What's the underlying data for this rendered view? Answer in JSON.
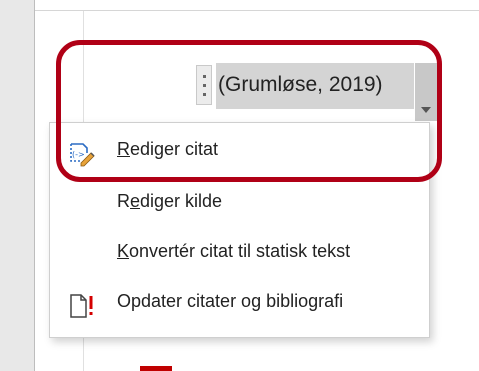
{
  "citation": {
    "text": "(Grumløse, 2019)"
  },
  "context_menu": {
    "items": [
      {
        "id": "edit-citation",
        "accel": "R",
        "rest": "ediger citat",
        "icon": "edit-citation-icon"
      },
      {
        "id": "edit-source",
        "pre": "R",
        "accel": "e",
        "rest": "diger kilde",
        "icon": ""
      },
      {
        "id": "convert-citation",
        "accel": "K",
        "rest": "onvertér citat til statisk tekst",
        "icon": ""
      },
      {
        "id": "update-citations",
        "accel": "",
        "rest": "Opdater citater og bibliografi",
        "icon": "update-document-icon"
      }
    ]
  },
  "colors": {
    "highlight": "#b00016",
    "field_shading": "#d4d4d4",
    "icon_blue": "#2b6cc4",
    "icon_red": "#d40000"
  }
}
